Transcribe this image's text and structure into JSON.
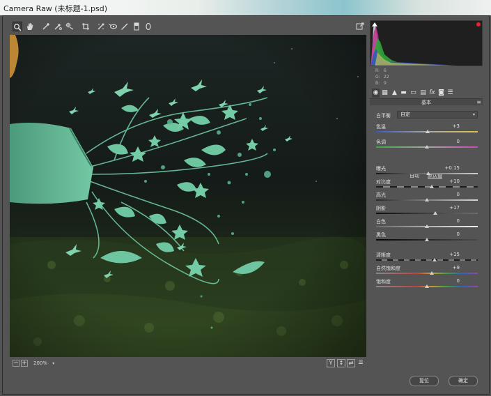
{
  "window": {
    "title": "Camera Raw (未标题-1.psd)"
  },
  "toolbar": {
    "tools": [
      "zoom-icon",
      "hand-icon",
      "white-balance-icon",
      "color-sampler-icon",
      "targeted-adjust-icon",
      "crop-icon",
      "spot-removal-icon",
      "red-eye-icon",
      "adjustment-brush-icon",
      "graduated-filter-icon",
      "radial-filter-icon"
    ],
    "fullscreen_icon": "fullscreen-icon"
  },
  "preview_bar": {
    "zoom": "200%",
    "zoom_out": "−",
    "zoom_in": "+",
    "view_y": "Y",
    "view_before_after": "↕",
    "view_swap": "⇄",
    "view_settings": "☰"
  },
  "histogram": {
    "readouts": [
      {
        "label": "R:",
        "value": "6"
      },
      {
        "label": "G:",
        "value": "22"
      },
      {
        "label": "B:",
        "value": "9"
      }
    ],
    "clip_shadow_color": "#ffffff",
    "clip_highlight_color": "#e8232c"
  },
  "panel": {
    "title": "基本",
    "tabs": [
      "basic-icon",
      "tone-curve-icon",
      "detail-icon",
      "hsl-icon",
      "split-toning-icon",
      "lens-icon",
      "fx-icon",
      "camera-calibration-icon",
      "presets-icon"
    ],
    "white_balance": {
      "label": "白平衡",
      "value": "自定"
    },
    "auto": "自动",
    "default": "默认值",
    "temp_tint": [
      {
        "label": "色温",
        "value": "+3",
        "pos": 0.51
      },
      {
        "label": "色调",
        "value": "0",
        "pos": 0.5
      }
    ],
    "tone": [
      {
        "label": "曝光",
        "value": "+0.15",
        "pos": 0.515
      },
      {
        "label": "对比度",
        "value": "+10",
        "pos": 0.55
      },
      {
        "label": "高光",
        "value": "0",
        "pos": 0.5
      },
      {
        "label": "阴影",
        "value": "+17",
        "pos": 0.585
      },
      {
        "label": "白色",
        "value": "0",
        "pos": 0.5
      },
      {
        "label": "黑色",
        "value": "0",
        "pos": 0.5
      }
    ],
    "presence": [
      {
        "label": "清晰度",
        "value": "+15",
        "pos": 0.575
      },
      {
        "label": "自然饱和度",
        "value": "+9",
        "pos": 0.545
      },
      {
        "label": "饱和度",
        "value": "0",
        "pos": 0.5
      }
    ]
  },
  "footer": {
    "reset": "复位",
    "ok": "确定"
  }
}
